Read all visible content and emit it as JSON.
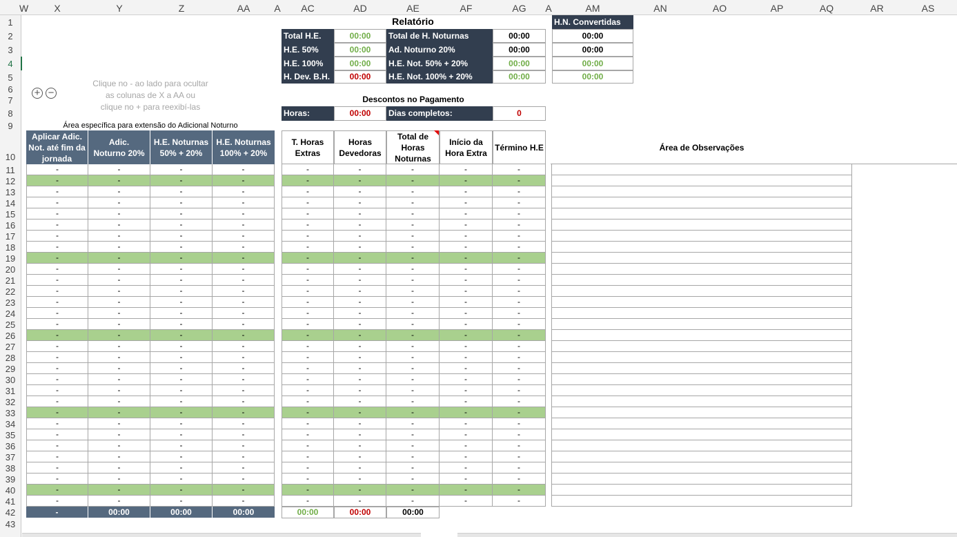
{
  "column_headers": [
    "W",
    "X",
    "Y",
    "Z",
    "AA",
    "A",
    "AC",
    "AD",
    "AE",
    "AF",
    "AG",
    "A",
    "AM",
    "AN",
    "AO",
    "AP",
    "AQ",
    "AR",
    "AS"
  ],
  "relatorio": {
    "title": "Relatório",
    "left_labels": [
      "Total H.E.",
      "H.E. 50%",
      "H.E. 100%",
      "H. Dev. B.H."
    ],
    "left_values": [
      "00:00",
      "00:00",
      "00:00",
      "00:00"
    ],
    "right_labels": [
      "Total de H. Noturnas",
      "Ad. Noturno 20%",
      "H.E. Not. 50% + 20%",
      "H.E. Not. 100% + 20%"
    ],
    "right_values": [
      "00:00",
      "00:00",
      "00:00",
      "00:00"
    ],
    "converted_title": "H.N. Convertidas",
    "converted_values": [
      "00:00",
      "00:00",
      "00:00",
      "00:00"
    ]
  },
  "hint": {
    "line1": "Clique no - ao lado para ocultar",
    "line2": "as colunas de X a AA ou",
    "line3": "clique no + para reexibí-las",
    "plus": "+",
    "minus": "−"
  },
  "descontos": {
    "title": "Descontos no Pagamento",
    "hours_label": "Horas:",
    "hours_value": "00:00",
    "days_label": "Dias completos:",
    "days_value": "0"
  },
  "night_area_caption": "Área específica para extensão do Adicional Noturno",
  "left_headers": [
    "Aplicar Adic. Not. até fim da jornada",
    "Adic. Noturno 20%",
    "H.E. Noturnas 50% + 20%",
    "H.E. Noturnas 100% + 20%"
  ],
  "mid_headers": [
    "T. Horas Extras",
    "Horas Devedoras",
    "Total de Horas Noturnas",
    "Início da Hora Extra",
    "Término H.E"
  ],
  "obs_header": "Área de Observações",
  "cell_dash": "-",
  "left_totals": [
    "-",
    "00:00",
    "00:00",
    "00:00"
  ],
  "mid_totals": [
    "00:00",
    "00:00",
    "00:00"
  ],
  "colors": {
    "dark": "#323e4f",
    "slate": "#55697f",
    "green_row": "#a9d08e",
    "green_text": "#70ad47",
    "red_text": "#c00000"
  }
}
